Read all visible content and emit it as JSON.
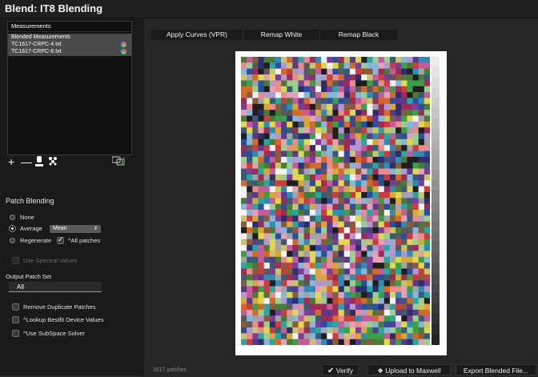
{
  "window": {
    "title": "Blend: IT8 Blending"
  },
  "measurements": {
    "header": "Measurements",
    "items": [
      {
        "label": "Blended Measurements",
        "icon": ""
      },
      {
        "label": "TC1617-CRPC-4.txt",
        "icon": "color-wheel-icon"
      },
      {
        "label": "TC1617-CRPC-6.txt",
        "icon": "color-wheel-icon"
      }
    ],
    "toolbar_icons": [
      "add-icon",
      "remove-icon",
      "instrument-icon",
      "cluster-icon",
      "settings-icon"
    ]
  },
  "patch_blending": {
    "title": "Patch Blending",
    "options": {
      "none": "None",
      "average": "Average",
      "regenerate": "Regenerate"
    },
    "selected": "average",
    "average_method": "Mean",
    "all_patches_label": "^All patches",
    "all_patches_checked": true,
    "use_spectral_label": "Use Spectral Values",
    "use_spectral_checked": false
  },
  "output_patch_set": {
    "title": "Output Patch Set",
    "value": "All"
  },
  "options": {
    "remove_duplicates": {
      "label": "Remove Duplicate Patches",
      "checked": false
    },
    "lookup_bestfit": {
      "label": "^Lookup Bestfit Device Values",
      "checked": false
    },
    "use_subspace": {
      "label": "^Use SubSpace Solver",
      "checked": false
    }
  },
  "actions": {
    "apply_curves": "Apply Curves (VPR)",
    "remap_white": "Remap White",
    "remap_black": "Remap Black"
  },
  "footer": {
    "patch_count": "1617 patches",
    "verify": "Verify",
    "upload": "Upload to Maxwell",
    "export": "Export Blended File..."
  },
  "chart_data": {
    "type": "heatmap",
    "description_columns": 33,
    "description_rows": 49,
    "palette": [
      "#c83d3d",
      "#d9a638",
      "#e0d84a",
      "#3e9e47",
      "#2f8bb5",
      "#2a4f9e",
      "#7a3d99",
      "#c55b9b",
      "#e88c8c",
      "#9ad08e",
      "#87b7d8",
      "#b597d0",
      "#1e1e1e",
      "#595959",
      "#a3a3a3",
      "#f2f2f2",
      "#8a5b3a",
      "#4a7a3a",
      "#d46a2a",
      "#2aa69e",
      "#9e2a5a",
      "#5a3a8a",
      "#c9c36a",
      "#3a5a7a",
      "#e5a0b5",
      "#2e2e6e"
    ]
  }
}
